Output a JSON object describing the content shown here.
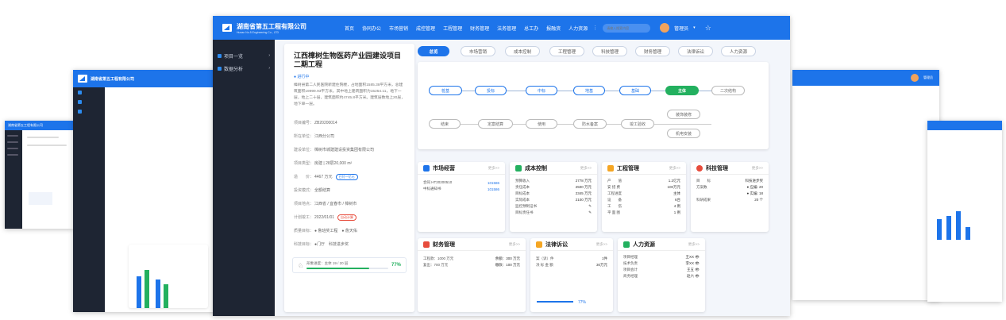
{
  "brand": {
    "title": "湖南省第五工程有限公司",
    "subtitle": "Hunan No.5 Engineering Co., LTD"
  },
  "topnav": [
    "首页",
    "协同办公",
    "市场营销",
    "成控管理",
    "工程管理",
    "财务管理",
    "法务管理",
    "总工办",
    "报融资",
    "人力资源"
  ],
  "search": {
    "placeholder": "请输入搜索内容"
  },
  "user": {
    "name": "管理员"
  },
  "sidebar": {
    "items": [
      {
        "label": "项目一览"
      },
      {
        "label": "数据分析"
      }
    ]
  },
  "project": {
    "title": "江西樟树生物医药产业园建设项目二期工程",
    "status": "● 进行中",
    "description": "樟树县第二人民医院新建住院楼，占地面积1585.38平方米，总建筑面积19999.93平方米。其中地上建筑面积为15254.11，地下一层，地上二十层，建筑面积约4745.8平方米。建筑层数地上20层，地下单一层。",
    "fields": [
      {
        "k": "项目编号：",
        "v": "ZB20200014"
      },
      {
        "k": "所在单位：",
        "v": "江西分公司"
      },
      {
        "k": "建设单位：",
        "v": "樟树市城建建设投资集团有限公司"
      },
      {
        "k": "项目类型：",
        "v": "房建 | 28层20,000 m²"
      },
      {
        "k": "造　　价：",
        "v": "4467 万元",
        "tag": "已付一亿元"
      },
      {
        "k": "投资模式：",
        "v": "全额结算"
      },
      {
        "k": "项目地点：",
        "v": "江西省 / 宜春市 / 樟树市"
      },
      {
        "k": "计划竣工：",
        "v": "2022/01/01",
        "tag": "自动计算"
      },
      {
        "k": "质量目标：",
        "v": "● 鲁班奖工程　● 詹天佑"
      },
      {
        "k": "科技目标：",
        "v": "●门厅　科技进步奖"
      }
    ],
    "progress": {
      "label": "形象进度：主体 19 / 20 层",
      "value": "77%",
      "fraction": 0.77
    }
  },
  "tabs": [
    "总览",
    "市场营销",
    "成本控制",
    "工程管理",
    "科技管理",
    "财务管理",
    "法律诉讼",
    "人力资源"
  ],
  "flow": {
    "top": [
      "桩基",
      "投标",
      "中标",
      "地基",
      "基础",
      "主体",
      "二次结构"
    ],
    "bottom": [
      "结束",
      "定案结算",
      "使用",
      "防水备案",
      "竣工验收",
      "机电安装"
    ],
    "branch": "装饰装修"
  },
  "cards": {
    "market": {
      "title": "市场经营",
      "more": "更多>>",
      "rows": [
        {
          "k": "合同 HT20200510",
          "v": "101586"
        },
        {
          "k": "中标通知书",
          "v": "101586"
        }
      ]
    },
    "cost": {
      "title": "成本控制",
      "more": "更多>>",
      "rows": [
        {
          "k": "预算收入",
          "v": "2778 万元"
        },
        {
          "k": "责任成本",
          "v": "2500 万元"
        },
        {
          "k": "目标成本",
          "v": "2345 万元"
        },
        {
          "k": "实际成本",
          "v": "2100 万元"
        },
        {
          "k": "监控预制证书",
          "v": "✎"
        },
        {
          "k": "目标责任书",
          "v": "✎"
        }
      ]
    },
    "eng": {
      "title": "工程管理",
      "more": "更多>>",
      "rows": [
        {
          "k": "产　　值",
          "v": "1.2亿元"
        },
        {
          "k": "安 措 费",
          "v": "100万元"
        },
        {
          "k": "工程进度",
          "v": "主体"
        },
        {
          "k": "设　　备",
          "v": "6台"
        },
        {
          "k": "工　　伤",
          "v": "4 例"
        },
        {
          "k": "平 面 图",
          "v": "1 例"
        }
      ]
    },
    "tech": {
      "title": "科技管理",
      "more": "更多>>",
      "rows": [
        {
          "k": "目　　标",
          "v": "科技进步奖"
        },
        {
          "k": "方案数",
          "v": "● 应编: 20"
        },
        {
          "k": "",
          "v": "● 实编: 18"
        },
        {
          "k": "科研成果",
          "v": "20 个"
        }
      ]
    },
    "fin": {
      "title": "财务管理",
      "more": "更多>>",
      "rows": [
        {
          "k": "工程款：1000 万元",
          "v": "余额：300 万元"
        },
        {
          "k": "复出：700 万元",
          "v": "缴款：100 万元"
        }
      ]
    },
    "law": {
      "title": "法律诉讼",
      "more": "更多>>",
      "rows": [
        {
          "k": "案（诉）件",
          "v": "1件"
        },
        {
          "k": "决 标 金 额",
          "v": "30万元"
        }
      ]
    },
    "hr": {
      "title": "人力资源",
      "more": "更多>>",
      "rows": [
        {
          "k": "项目经理",
          "v": "王XX 👁"
        },
        {
          "k": "技术负责",
          "v": "李XX 👁"
        },
        {
          "k": "项目会计",
          "v": "王五 👁"
        },
        {
          "k": "商务经理",
          "v": "赵六 👁"
        }
      ],
      "progress": "77%"
    }
  },
  "colors": {
    "primary": "#1d74ea",
    "green": "#23b05f",
    "sidebar": "#1e2533"
  }
}
